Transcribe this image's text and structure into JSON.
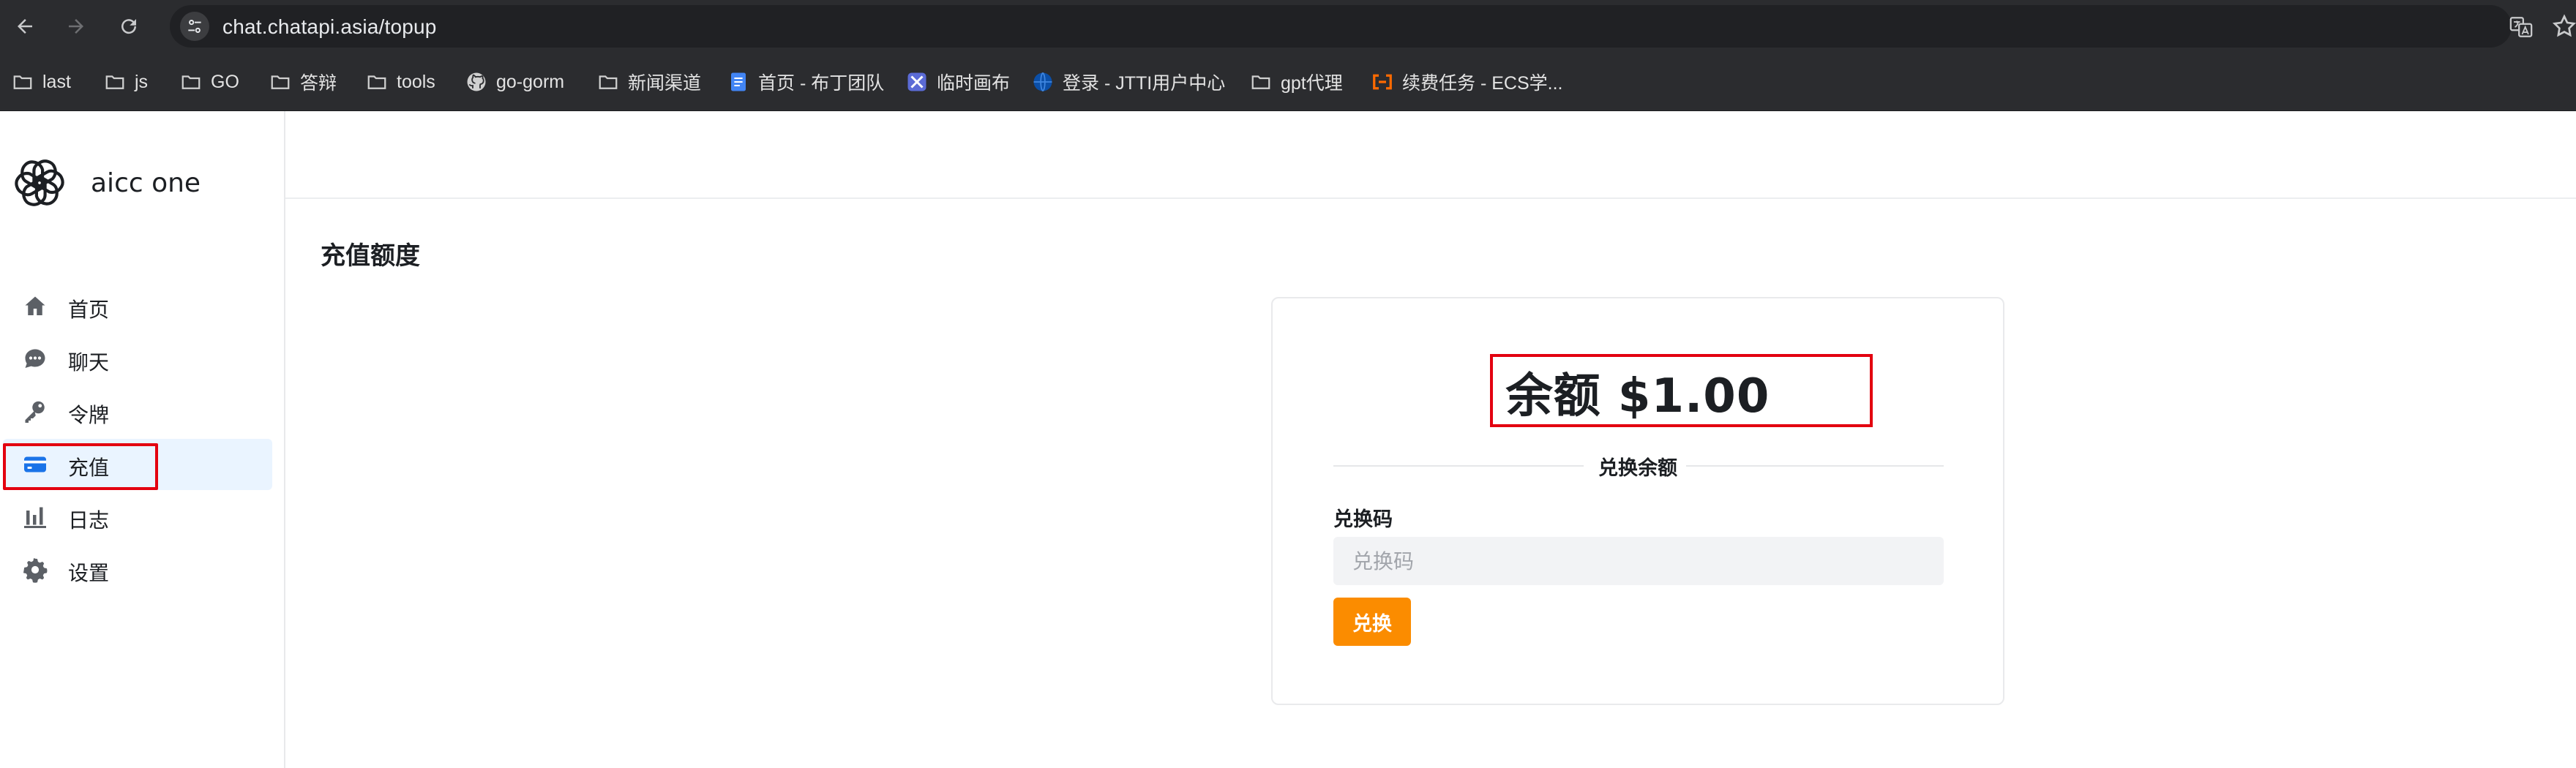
{
  "browser": {
    "url": "chat.chatapi.asia/topup",
    "bookmarks": [
      {
        "label": "last",
        "icon": "folder-icon"
      },
      {
        "label": "js",
        "icon": "folder-icon"
      },
      {
        "label": "GO",
        "icon": "folder-icon"
      },
      {
        "label": "答辩",
        "icon": "folder-icon"
      },
      {
        "label": "tools",
        "icon": "folder-icon"
      },
      {
        "label": "go-gorm",
        "icon": "github-icon"
      },
      {
        "label": "新闻渠道",
        "icon": "folder-icon"
      },
      {
        "label": "首页 - 布丁团队",
        "icon": "doc-icon"
      },
      {
        "label": "临时画布",
        "icon": "canvas-icon"
      },
      {
        "label": "登录 - JTTI用户中心",
        "icon": "globe-icon"
      },
      {
        "label": "gpt代理",
        "icon": "folder-icon"
      },
      {
        "label": "续费任务 - ECS学...",
        "icon": "aliyun-icon"
      }
    ]
  },
  "app": {
    "brand": "aicc one",
    "menu": [
      {
        "label": "首页",
        "icon": "home-icon"
      },
      {
        "label": "聊天",
        "icon": "chat-icon"
      },
      {
        "label": "令牌",
        "icon": "key-icon"
      },
      {
        "label": "充值",
        "icon": "card-icon",
        "active": true
      },
      {
        "label": "日志",
        "icon": "chart-icon"
      },
      {
        "label": "设置",
        "icon": "gear-icon"
      }
    ],
    "page_title": "充值额度",
    "topup": {
      "balance_text": "余额 $1.00",
      "divider_text": "兑换余额",
      "field_label": "兑换码",
      "input_placeholder": "兑换码",
      "input_value": "",
      "button_label": "兑换"
    }
  },
  "colors": {
    "accent_active": "#eaf4ff",
    "card_icon_blue": "#1a73e8",
    "redeem_button": "#fb8c00",
    "annotation_red": "#e3000f"
  }
}
